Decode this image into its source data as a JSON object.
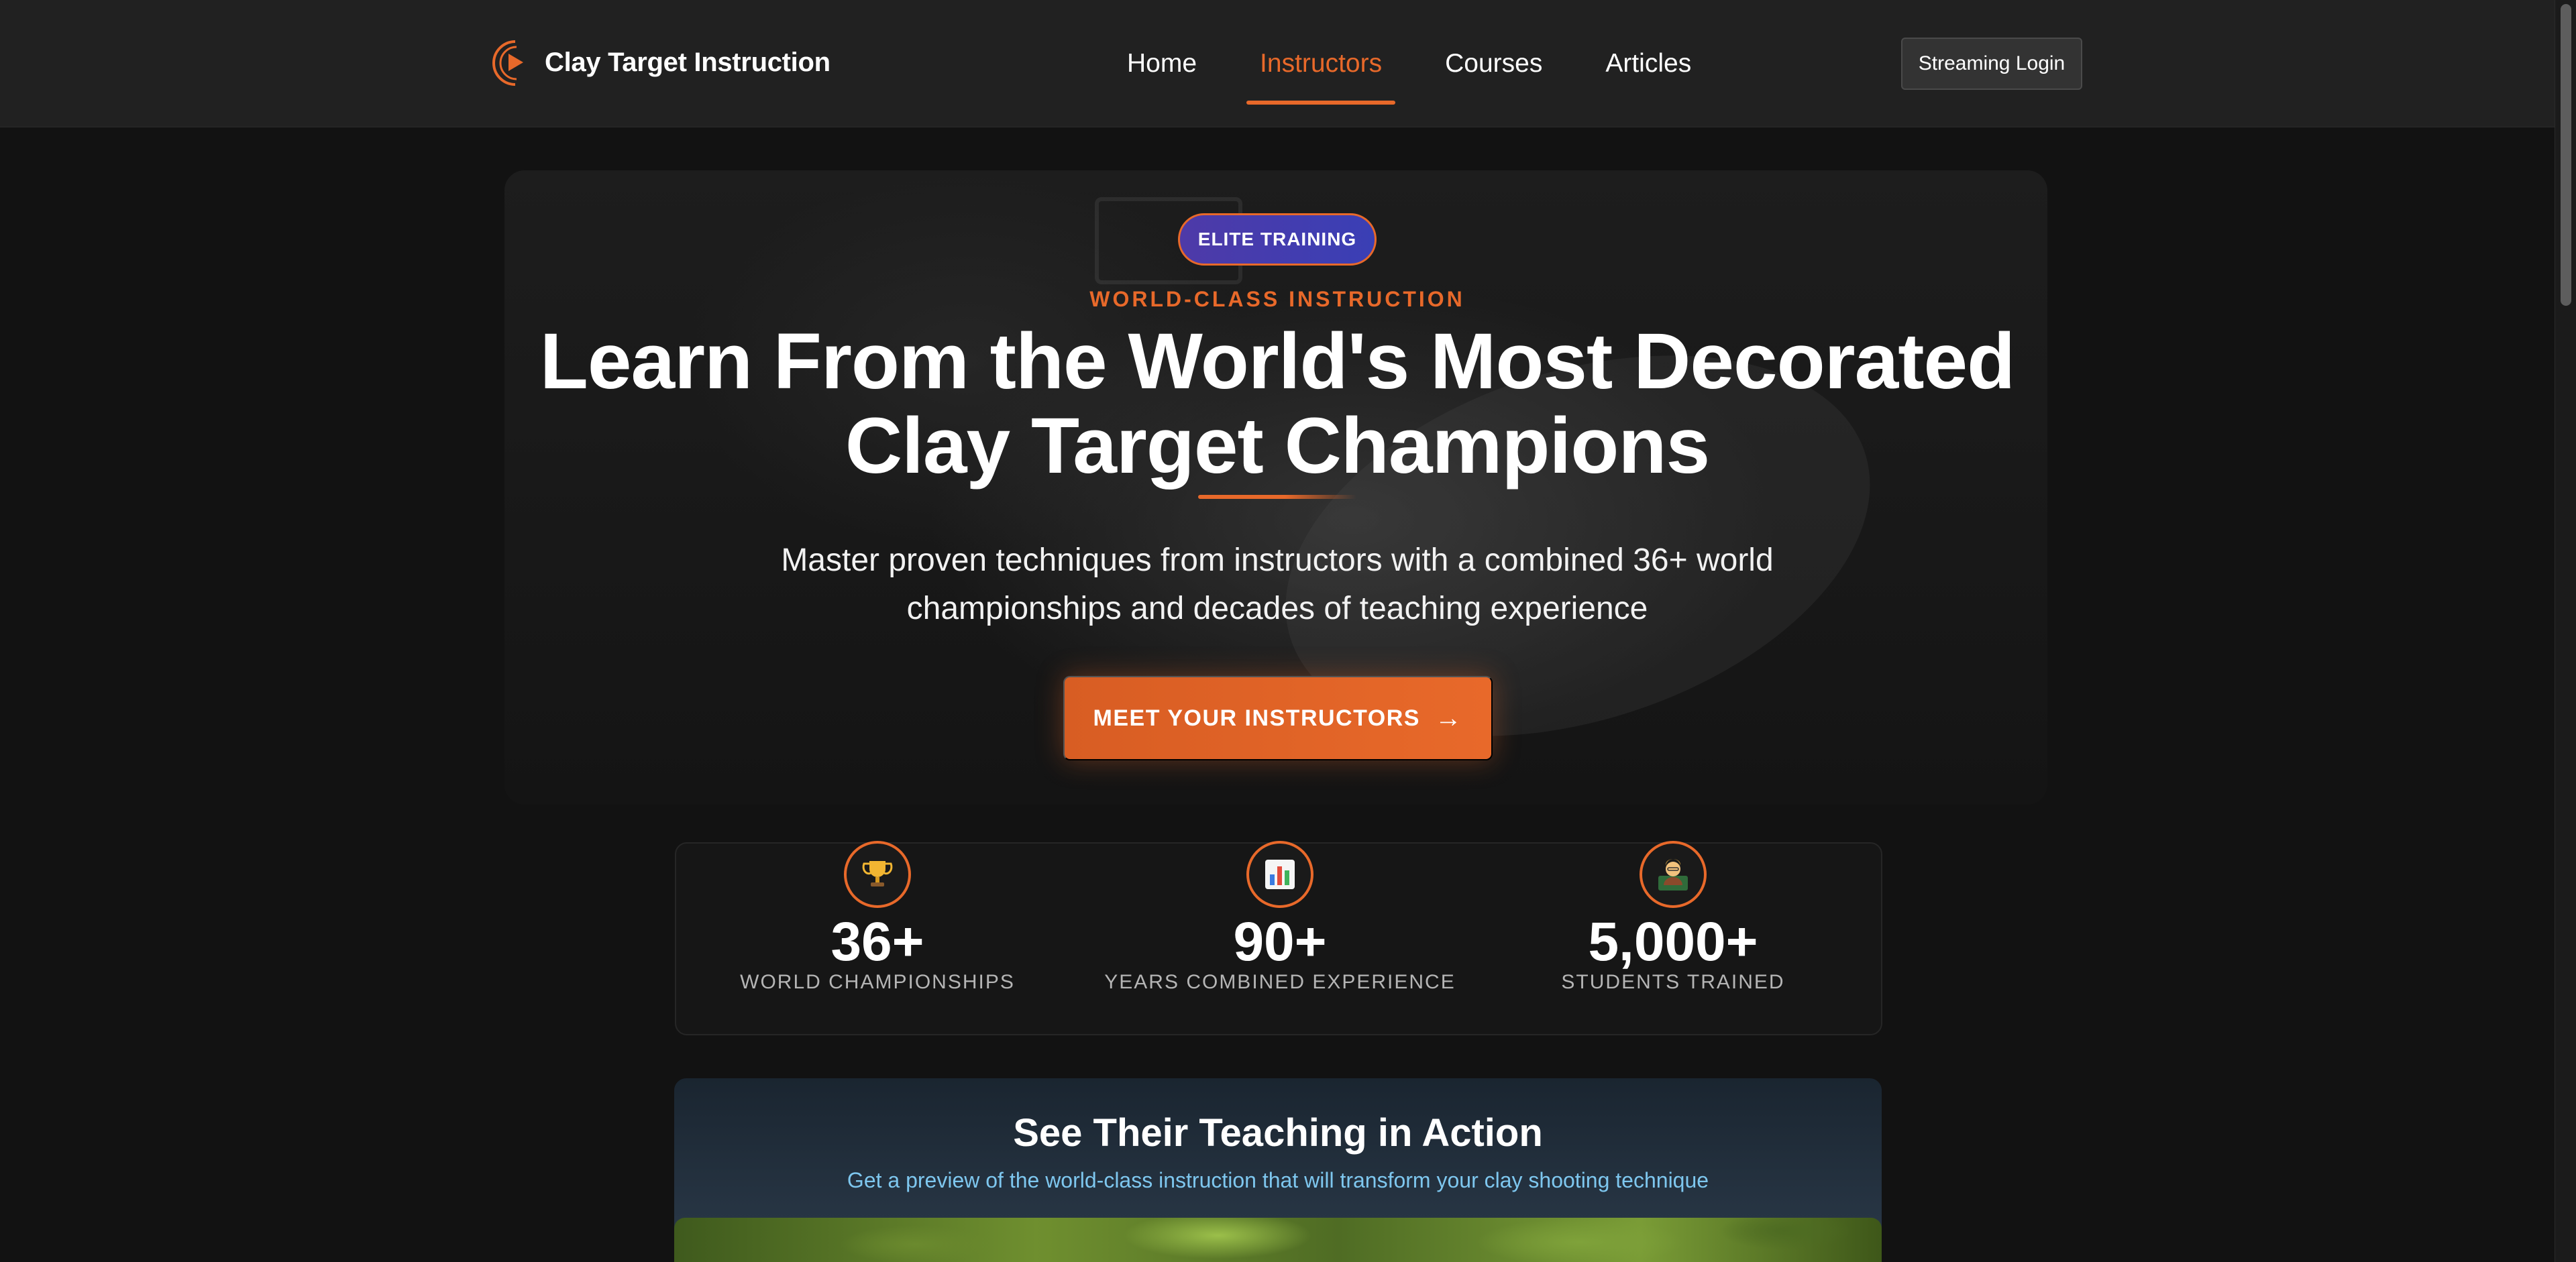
{
  "colors": {
    "accent": "#e8692a",
    "background": "#121212",
    "navbar": "#212121",
    "badge": "#4e3aa8",
    "preview_subtitle": "#7ec7ef"
  },
  "navbar": {
    "brand": "Clay Target Instruction",
    "links": [
      {
        "label": "Home",
        "active": false
      },
      {
        "label": "Instructors",
        "active": true
      },
      {
        "label": "Courses",
        "active": false
      },
      {
        "label": "Articles",
        "active": false
      }
    ],
    "streaming_login": "Streaming Login"
  },
  "hero": {
    "badge": "ELITE TRAINING",
    "eyebrow": "WORLD-CLASS INSTRUCTION",
    "title_line1": "Learn From the World's Most Decorated",
    "title_line2": "Clay Target Champions",
    "subtitle_line1": "Master proven techniques from instructors with a combined 36+ world",
    "subtitle_line2": "championships and decades of teaching experience",
    "cta": "MEET YOUR INSTRUCTORS",
    "cta_arrow": "→"
  },
  "stats": [
    {
      "icon": "trophy-icon",
      "glyph": "🏆",
      "value": "36+",
      "label": "WORLD CHAMPIONSHIPS"
    },
    {
      "icon": "bar-chart-icon",
      "glyph": "📊",
      "value": "90+",
      "label": "YEARS COMBINED EXPERIENCE"
    },
    {
      "icon": "teacher-icon",
      "glyph": "🧑‍🏫",
      "value": "5,000+",
      "label": "STUDENTS TRAINED"
    }
  ],
  "preview": {
    "title": "See Their Teaching in Action",
    "subtitle": "Get a preview of the world-class instruction that will transform your clay shooting technique"
  }
}
